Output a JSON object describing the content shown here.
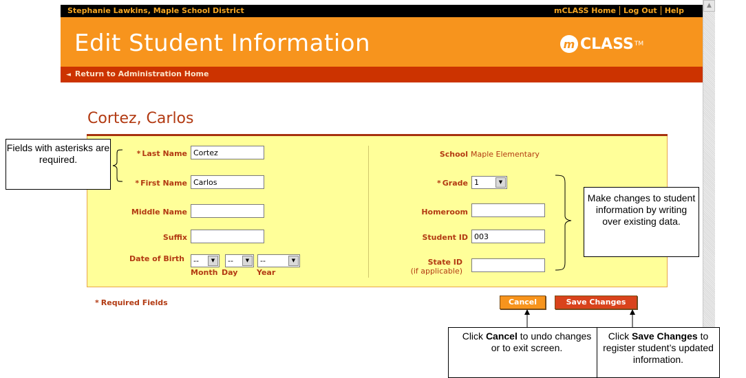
{
  "header": {
    "user_district": "Stephanie Lawkins, Maple School District",
    "links": [
      "mCLASS Home",
      "Log Out",
      "Help"
    ],
    "title": "Edit Student Information",
    "logo_mark": "m",
    "logo_text": "CLASS",
    "logo_tm": "TM",
    "return_link": "Return to Administration Home"
  },
  "student": {
    "name": "Cortez, Carlos"
  },
  "form": {
    "asterisk": "*",
    "last_name": {
      "label": "Last Name",
      "value": "Cortez"
    },
    "first_name": {
      "label": "First Name",
      "value": "Carlos"
    },
    "middle_name": {
      "label": "Middle Name",
      "value": ""
    },
    "suffix": {
      "label": "Suffix",
      "value": ""
    },
    "dob": {
      "label": "Date of Birth",
      "month": "--",
      "day": "--",
      "year": "--",
      "month_label": "Month",
      "day_label": "Day",
      "year_label": "Year"
    },
    "school": {
      "label": "School",
      "value": "Maple Elementary"
    },
    "grade": {
      "label": "Grade",
      "value": "1"
    },
    "homeroom": {
      "label": "Homeroom",
      "value": ""
    },
    "student_id": {
      "label": "Student ID",
      "value": "003"
    },
    "state_id": {
      "label": "State ID",
      "sublabel": "(if applicable)",
      "value": ""
    },
    "required_note": "Required Fields"
  },
  "buttons": {
    "cancel": "Cancel",
    "save": "Save Changes"
  },
  "callouts": {
    "required_text": "Fields with asterisks are required.",
    "changes_text": "Make changes to student information by writing over existing data.",
    "cancel_pre": "Click ",
    "cancel_bold": "Cancel",
    "cancel_post": " to undo changes or to exit screen.",
    "save_pre": "Click ",
    "save_bold": "Save Changes",
    "save_post": " to register student’s updated information."
  },
  "colors": {
    "orange": "#f7941d",
    "red": "#cc3300",
    "panel": "#ffff99",
    "label": "#b23a12"
  },
  "icons": {
    "return_arrow": "arrow-left-icon",
    "dropdown": "chevron-down-icon",
    "scroll_up": "scroll-up-arrow-icon"
  }
}
